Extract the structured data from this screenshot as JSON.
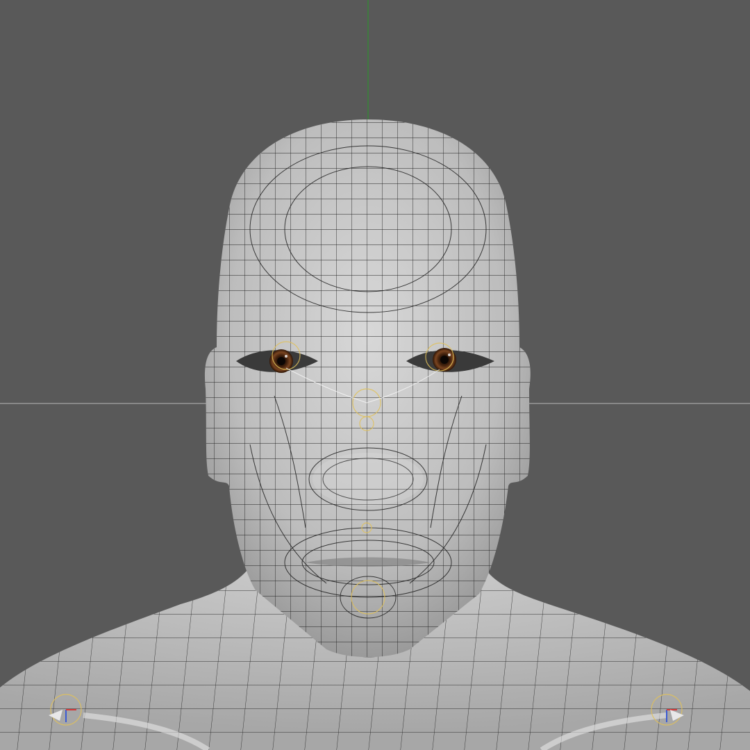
{
  "viewport": {
    "background_color": "#595959",
    "content": "wireframe-head-model",
    "y_axis_color": "#2f8f2f",
    "horizon_line_color": "#b8b8b8",
    "mesh_surface_color": "#c9c9c9",
    "mesh_edge_color": "#1e1e1e",
    "iris_color": "#6a3a18",
    "rig_control_color": "#e0c15a",
    "gizmo_colors": [
      "#d43b3b",
      "#3b5bd4"
    ]
  }
}
